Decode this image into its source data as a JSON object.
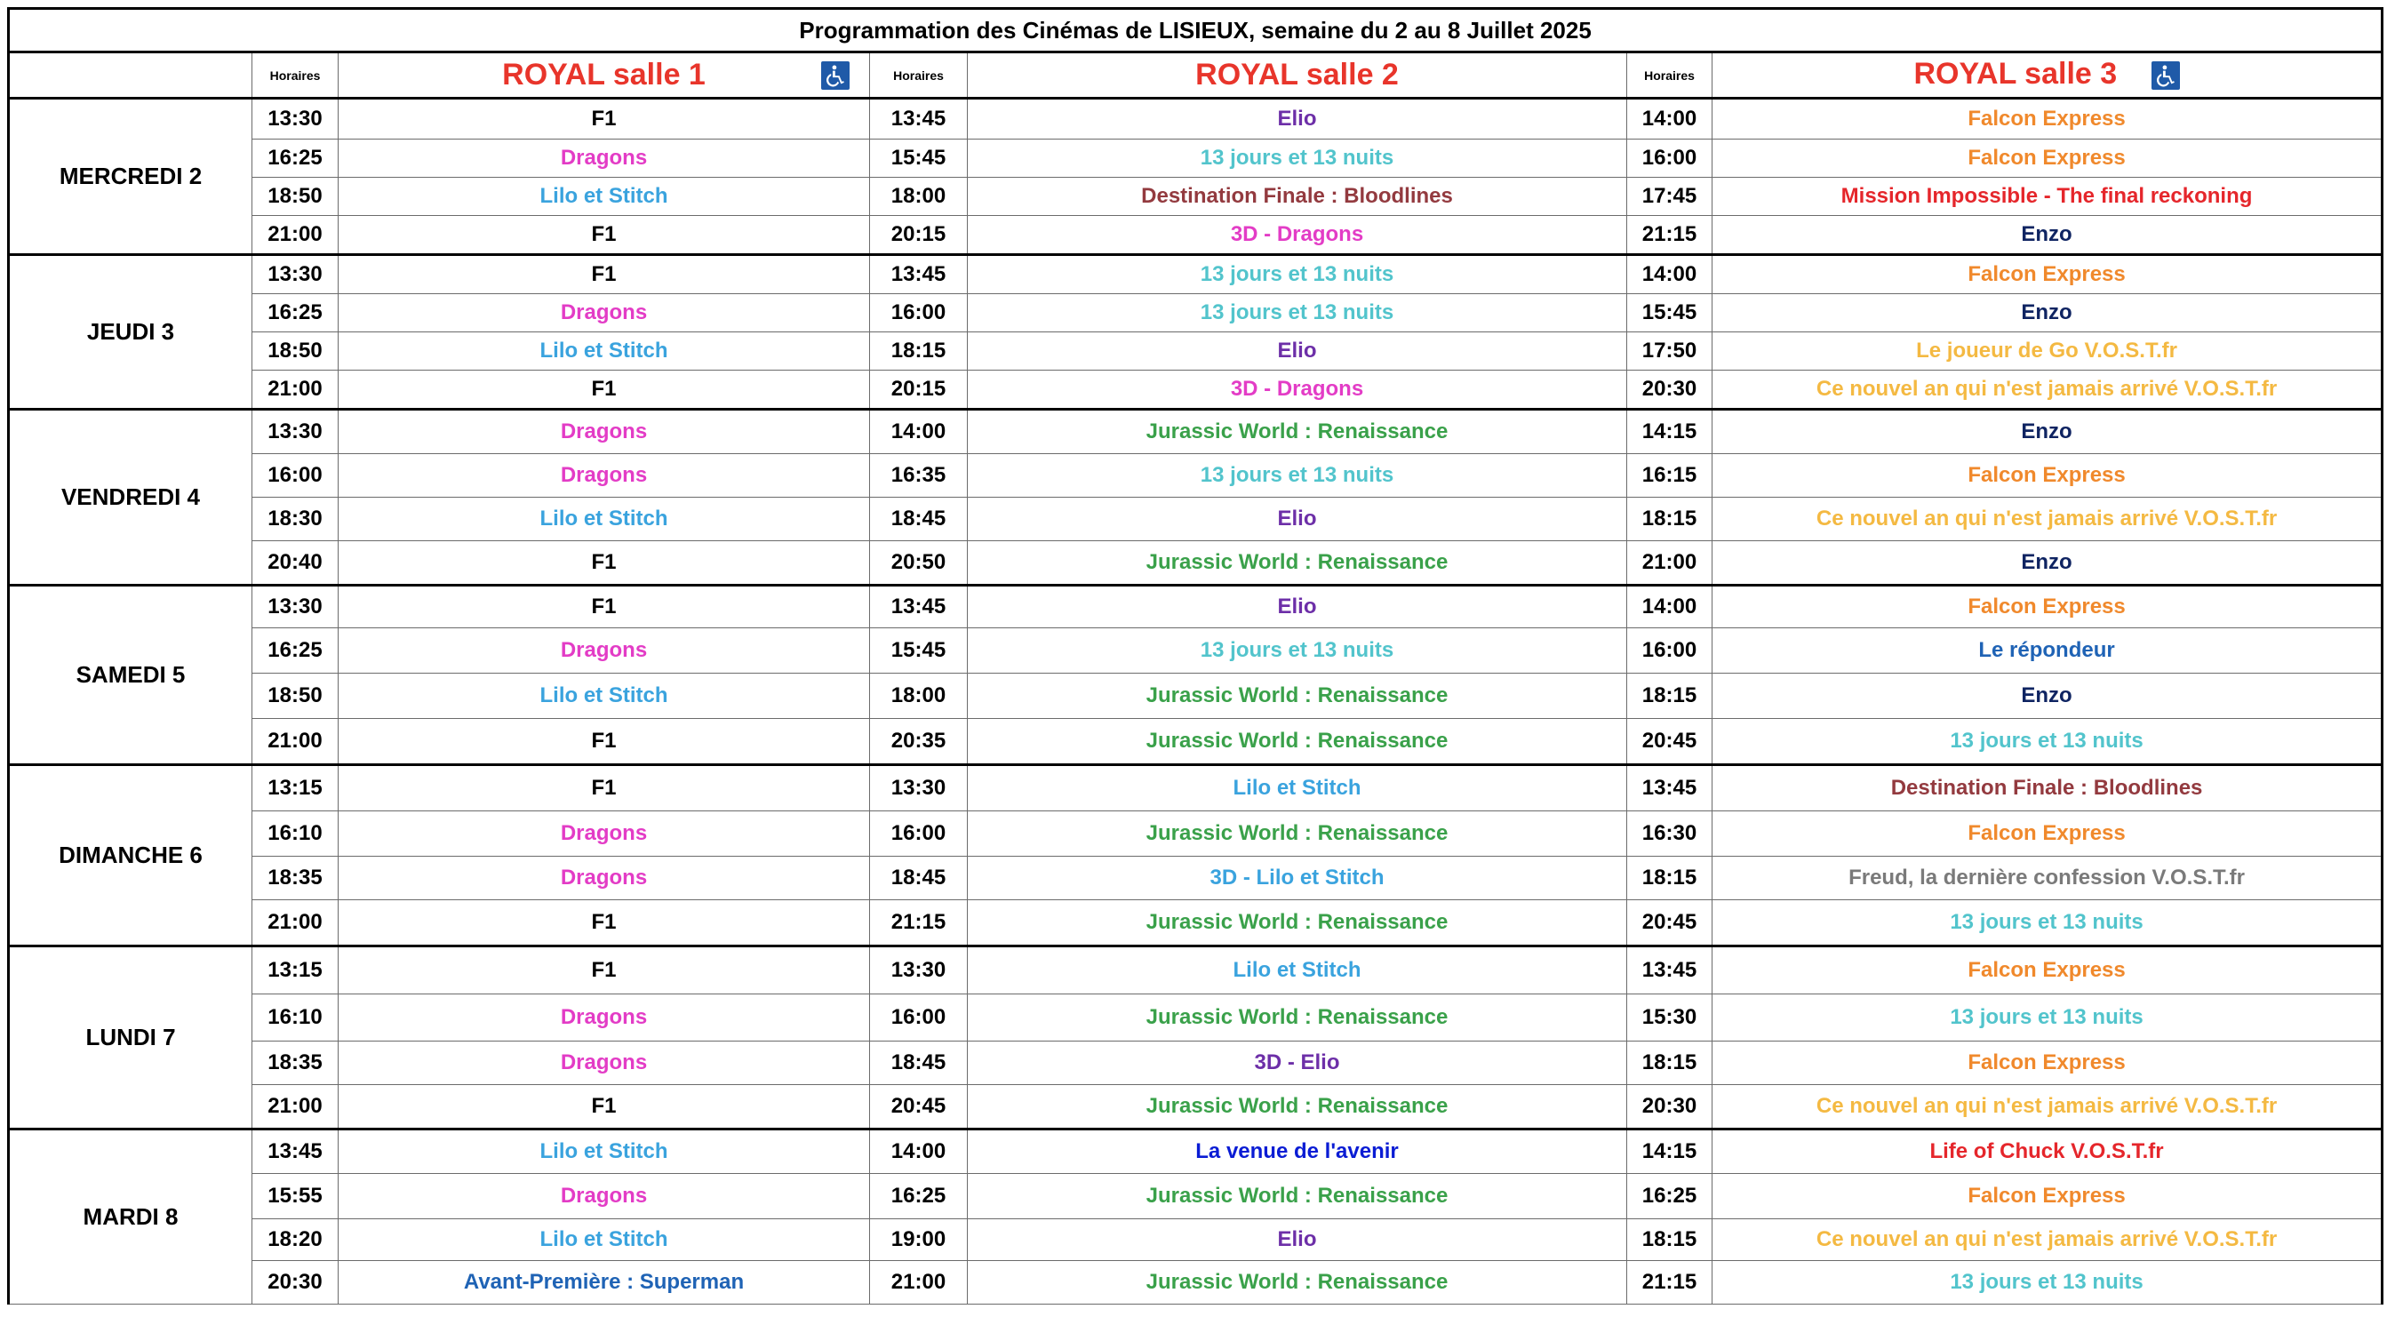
{
  "title": "Programmation des Cinémas de LISIEUX, semaine du 2 au 8 Juillet  2025",
  "horaires_label": "Horaires",
  "salles": [
    {
      "name": "ROYAL salle 1",
      "accessible": true
    },
    {
      "name": "ROYAL salle 2",
      "accessible": false
    },
    {
      "name": "ROYAL salle 3",
      "accessible": true
    }
  ],
  "colors": {
    "salle_title": "#e8352b",
    "access_icon": "#1f5aa8"
  },
  "days": [
    {
      "label": "MERCREDI 2",
      "rows": [
        {
          "t1": "13:30",
          "f1": "F1",
          "t2": "13:45",
          "f2": "Elio",
          "t3": "14:00",
          "f3": "Falcon Express"
        },
        {
          "t1": "16:25",
          "f1": "Dragons",
          "t2": "15:45",
          "f2": "13 jours et 13 nuits",
          "t3": "16:00",
          "f3": "Falcon Express"
        },
        {
          "t1": "18:50",
          "f1": "Lilo et Stitch",
          "t2": "18:00",
          "f2": "Destination Finale : Bloodlines",
          "t3": "17:45",
          "f3": "Mission Impossible - The final reckoning"
        },
        {
          "t1": "21:00",
          "f1": "F1",
          "t2": "20:15",
          "f2": "3D - Dragons",
          "t3": "21:15",
          "f3": "Enzo"
        }
      ]
    },
    {
      "label": "JEUDI  3",
      "rows": [
        {
          "t1": "13:30",
          "f1": "F1",
          "t2": "13:45",
          "f2": "13 jours et 13 nuits",
          "t3": "14:00",
          "f3": "Falcon Express"
        },
        {
          "t1": "16:25",
          "f1": "Dragons",
          "t2": "16:00",
          "f2": "13 jours et 13 nuits",
          "t3": "15:45",
          "f3": "Enzo"
        },
        {
          "t1": "18:50",
          "f1": "Lilo et Stitch",
          "t2": "18:15",
          "f2": "Elio",
          "t3": "17:50",
          "f3": "Le joueur de Go V.O.S.T.fr"
        },
        {
          "t1": "21:00",
          "f1": "F1",
          "t2": "20:15",
          "f2": "3D - Dragons",
          "t3": "20:30",
          "f3": "Ce nouvel an qui n'est jamais arrivé V.O.S.T.fr"
        }
      ]
    },
    {
      "label": "VENDREDI 4",
      "rows": [
        {
          "t1": "13:30",
          "f1": "Dragons",
          "t2": "14:00",
          "f2": "Jurassic World : Renaissance",
          "t3": "14:15",
          "f3": "Enzo"
        },
        {
          "t1": "16:00",
          "f1": "Dragons",
          "t2": "16:35",
          "f2": "13 jours et 13 nuits",
          "t3": "16:15",
          "f3": "Falcon Express"
        },
        {
          "t1": "18:30",
          "f1": "Lilo et Stitch",
          "t2": "18:45",
          "f2": "Elio",
          "t3": "18:15",
          "f3": "Ce nouvel an qui n'est jamais arrivé V.O.S.T.fr"
        },
        {
          "t1": "20:40",
          "f1": "F1",
          "t2": "20:50",
          "f2": "Jurassic World : Renaissance",
          "t3": "21:00",
          "f3": "Enzo"
        }
      ]
    },
    {
      "label": "SAMEDI  5",
      "rows": [
        {
          "t1": "13:30",
          "f1": "F1",
          "t2": "13:45",
          "f2": "Elio",
          "t3": "14:00",
          "f3": "Falcon Express"
        },
        {
          "t1": "16:25",
          "f1": "Dragons",
          "t2": "15:45",
          "f2": "13 jours et 13 nuits",
          "t3": "16:00",
          "f3": "Le répondeur"
        },
        {
          "t1": "18:50",
          "f1": "Lilo et Stitch",
          "t2": "18:00",
          "f2": "Jurassic World : Renaissance",
          "t3": "18:15",
          "f3": "Enzo"
        },
        {
          "t1": "21:00",
          "f1": "F1",
          "t2": "20:35",
          "f2": "Jurassic World : Renaissance",
          "t3": "20:45",
          "f3": "13 jours et 13 nuits"
        }
      ]
    },
    {
      "label": "DIMANCHE 6",
      "rows": [
        {
          "t1": "13:15",
          "f1": "F1",
          "t2": "13:30",
          "f2": "Lilo et Stitch",
          "t3": "13:45",
          "f3": "Destination Finale : Bloodlines"
        },
        {
          "t1": "16:10",
          "f1": "Dragons",
          "t2": "16:00",
          "f2": "Jurassic World : Renaissance",
          "t3": "16:30",
          "f3": "Falcon Express"
        },
        {
          "t1": "18:35",
          "f1": "Dragons",
          "t2": "18:45",
          "f2": "3D - Lilo et Stitch",
          "t3": "18:15",
          "f3": "Freud, la dernière confession V.O.S.T.fr"
        },
        {
          "t1": "21:00",
          "f1": "F1",
          "t2": "21:15",
          "f2": "Jurassic World : Renaissance",
          "t3": "20:45",
          "f3": "13 jours et 13 nuits"
        }
      ]
    },
    {
      "label": "LUNDI  7",
      "rows": [
        {
          "t1": "13:15",
          "f1": "F1",
          "t2": "13:30",
          "f2": "Lilo et Stitch",
          "t3": "13:45",
          "f3": "Falcon Express"
        },
        {
          "t1": "16:10",
          "f1": "Dragons",
          "t2": "16:00",
          "f2": "Jurassic World : Renaissance",
          "t3": "15:30",
          "f3": "13 jours et 13 nuits"
        },
        {
          "t1": "18:35",
          "f1": "Dragons",
          "t2": "18:45",
          "f2": "3D - Elio",
          "t3": "18:15",
          "f3": "Falcon Express"
        },
        {
          "t1": "21:00",
          "f1": "F1",
          "t2": "20:45",
          "f2": "Jurassic World : Renaissance",
          "t3": "20:30",
          "f3": "Ce nouvel an qui n'est jamais arrivé V.O.S.T.fr"
        }
      ]
    },
    {
      "label": "MARDI 8",
      "rows": [
        {
          "t1": "13:45",
          "f1": "Lilo et Stitch",
          "t2": "14:00",
          "f2": "La venue de l'avenir",
          "t3": "14:15",
          "f3": "Life of Chuck V.O.S.T.fr"
        },
        {
          "t1": "15:55",
          "f1": "Dragons",
          "t2": "16:25",
          "f2": "Jurassic World : Renaissance",
          "t3": "16:25",
          "f3": "Falcon Express"
        },
        {
          "t1": "18:20",
          "f1": "Lilo et Stitch",
          "t2": "19:00",
          "f2": "Elio",
          "t3": "18:15",
          "f3": "Ce nouvel an qui n'est jamais arrivé V.O.S.T.fr"
        },
        {
          "t1": "20:30",
          "f1": "Avant-Première : Superman",
          "t2": "21:00",
          "f2": "Jurassic World : Renaissance",
          "t3": "21:15",
          "f3": "13 jours et 13 nuits"
        }
      ]
    }
  ]
}
